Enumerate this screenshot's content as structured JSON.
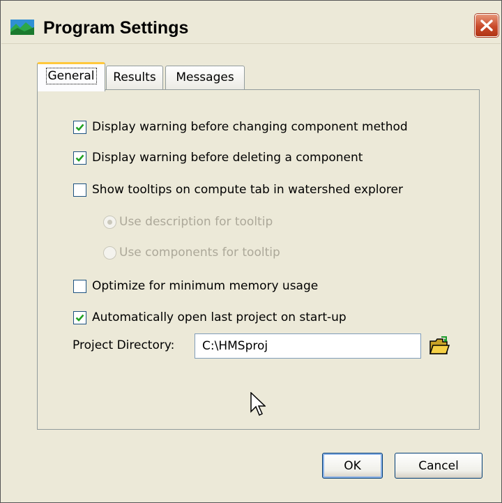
{
  "window": {
    "title": "Program Settings",
    "icon": "landscape-icon",
    "close_icon": "close-icon"
  },
  "tabs": [
    {
      "label": "General",
      "active": true
    },
    {
      "label": "Results",
      "active": false
    },
    {
      "label": "Messages",
      "active": false
    }
  ],
  "general": {
    "options": [
      {
        "label": "Display warning before changing component method",
        "checked": true
      },
      {
        "label": "Display warning before deleting a component",
        "checked": true
      },
      {
        "label": "Show tooltips on compute tab in watershed explorer",
        "checked": false
      }
    ],
    "tooltip_radios": [
      {
        "label": "Use description for tooltip",
        "selected": true,
        "enabled": false
      },
      {
        "label": "Use components for tooltip",
        "selected": false,
        "enabled": false
      }
    ],
    "memory_option": {
      "label": "Optimize for minimum memory usage",
      "checked": false
    },
    "autoopen_option": {
      "label": "Automatically open last project on start-up",
      "checked": true
    },
    "project_dir_label": "Project Directory:",
    "project_dir_value": "C:\\HMSproj",
    "browse_icon": "folder-open-icon"
  },
  "buttons": {
    "ok": "OK",
    "cancel": "Cancel"
  },
  "colors": {
    "dialog_bg": "#ece9d8",
    "checkmark": "#21a121",
    "close_button": "#c94a2a",
    "active_tab_highlight": "#ffc83c"
  }
}
